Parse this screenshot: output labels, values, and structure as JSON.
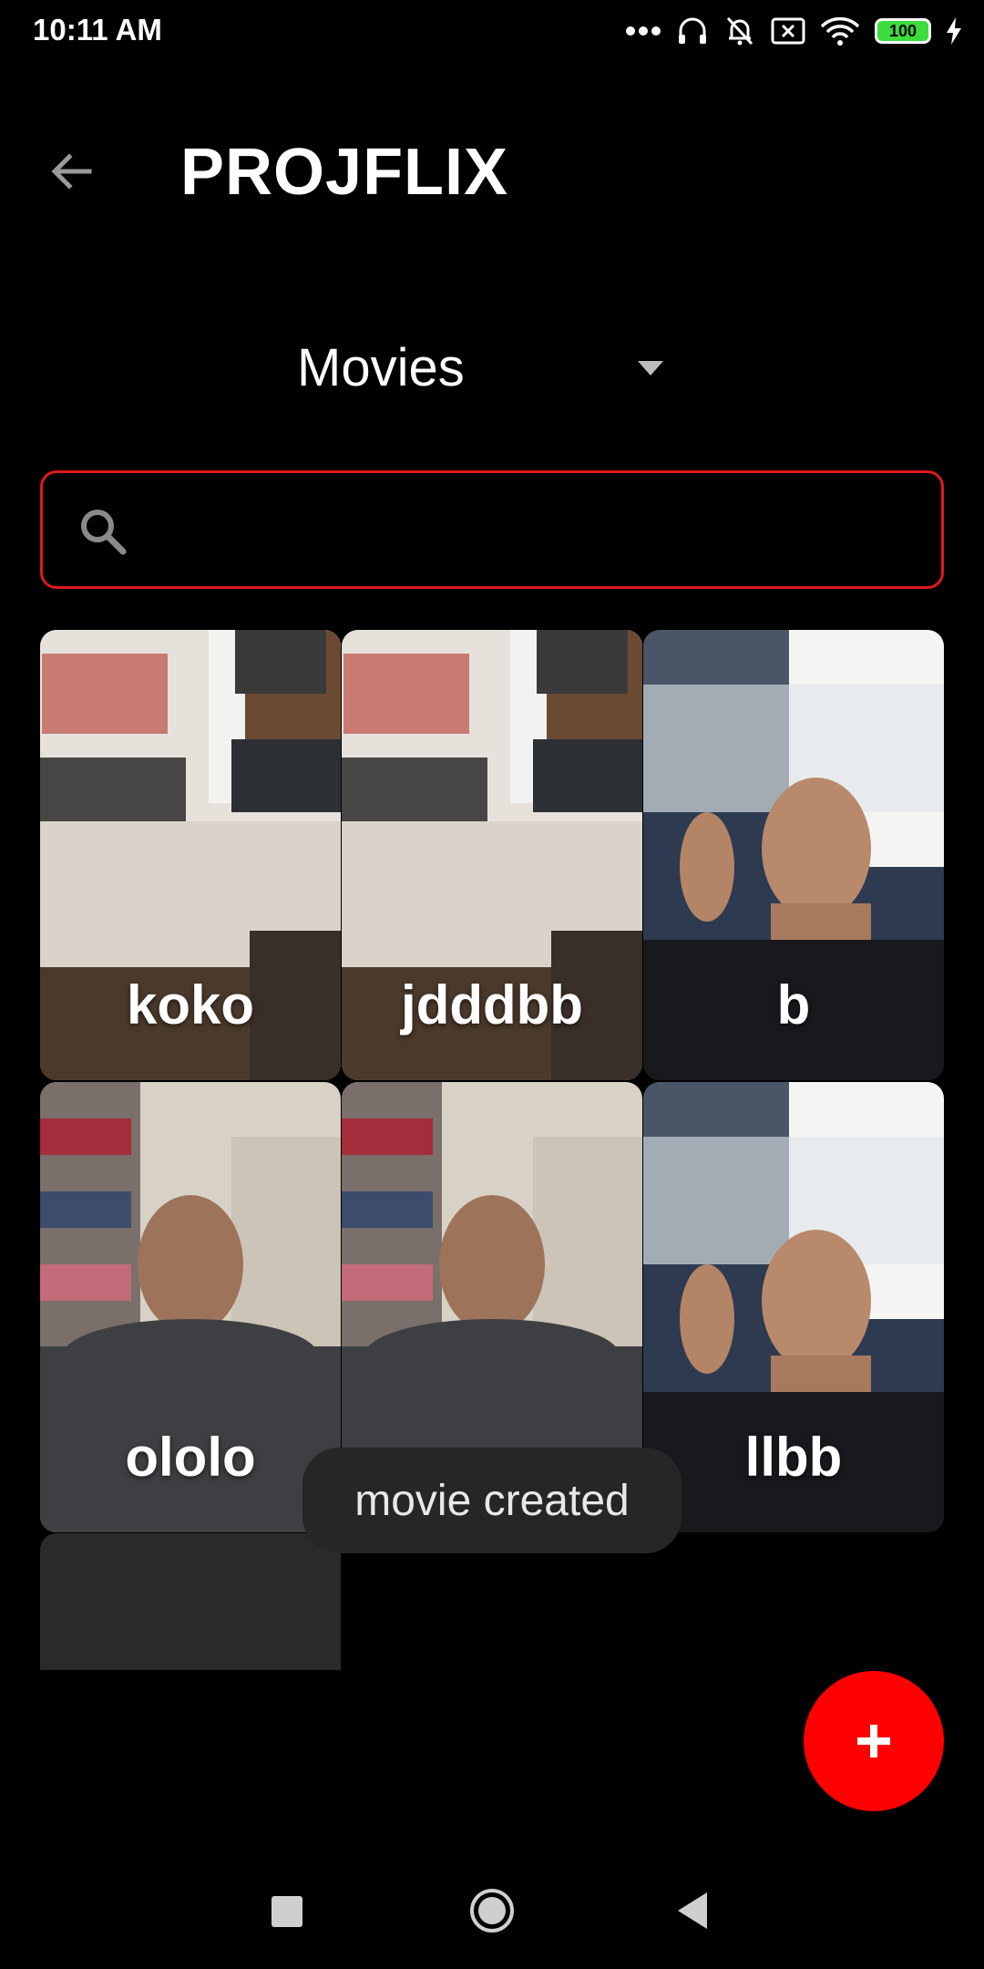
{
  "status_bar": {
    "time": "10:11 AM",
    "battery": "100"
  },
  "app_bar": {
    "title": "PROJFLIX"
  },
  "category_select": {
    "selected": "Movies"
  },
  "search": {
    "value": "",
    "placeholder": ""
  },
  "movies": [
    {
      "title": "koko"
    },
    {
      "title": "jdddbb"
    },
    {
      "title": "b"
    },
    {
      "title": "ololo"
    },
    {
      "title": ""
    },
    {
      "title": "llbb"
    }
  ],
  "toast": {
    "message": "movie created"
  },
  "colors": {
    "accent": "#ff0000",
    "search_border": "#e0191e",
    "background": "#000000"
  },
  "icons": {
    "back": "arrow-back-icon",
    "search": "search-icon",
    "dropdown": "triangle-down-icon",
    "fab": "plus-icon"
  }
}
